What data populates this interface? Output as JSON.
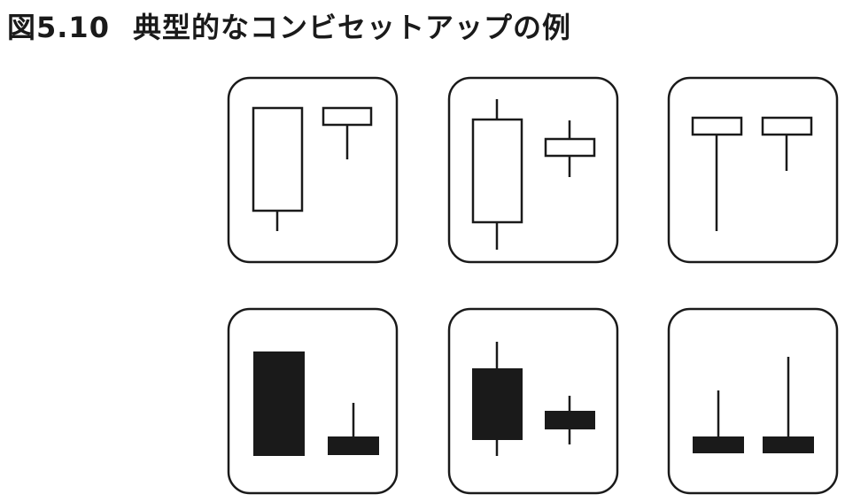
{
  "title": {
    "figure_number": "図5.10",
    "text": "典型的なコンビセットアップの例"
  },
  "colors": {
    "ink": "#1a1a1a",
    "background": "#ffffff"
  },
  "panels": [
    {
      "id": "top-left",
      "style": "hollow"
    },
    {
      "id": "top-middle",
      "style": "hollow"
    },
    {
      "id": "top-right",
      "style": "hollow"
    },
    {
      "id": "bottom-left",
      "style": "solid"
    },
    {
      "id": "bottom-middle",
      "style": "solid"
    },
    {
      "id": "bottom-right",
      "style": "solid"
    }
  ]
}
